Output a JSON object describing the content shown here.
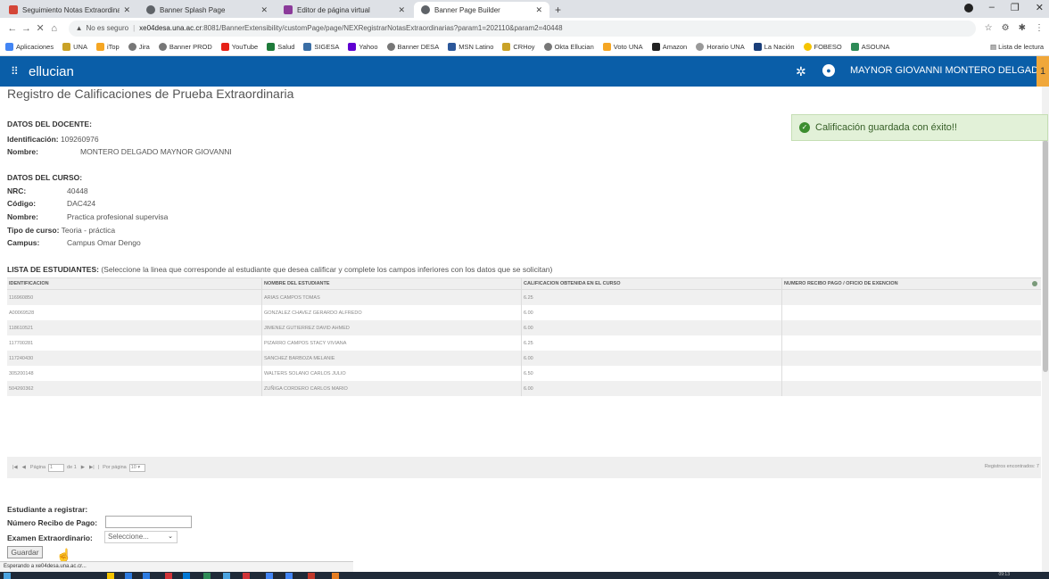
{
  "browser": {
    "tabs": [
      {
        "title": "Seguimiento Notas Extraordinar",
        "color": "#d44638"
      },
      {
        "title": "Banner Splash Page",
        "color": "#5f6368"
      },
      {
        "title": "Editor de página virtual",
        "color": "#8b3a9a"
      },
      {
        "title": "Banner Page Builder",
        "color": "#5f6368"
      }
    ],
    "address": {
      "security": "No es seguro",
      "host": "xe04desa.una.ac.cr",
      "path": ":8081/BannerExtensibility/customPage/page/NEXRegistrarNotasExtraordinarias?param1=202110&param2=40448"
    },
    "bookmarks": [
      "Aplicaciones",
      "UNA",
      "iTop",
      "Jira",
      "Banner PROD",
      "YouTube",
      "Salud",
      "SIGESA",
      "Yahoo",
      "Banner DESA",
      "MSN Latino",
      "CRHoy",
      "Okta Ellucian",
      "Voto UNA",
      "Amazon",
      "Horario UNA",
      "La Nación",
      "FOBESO",
      "ASOUNA"
    ],
    "reading_list": "Lista de lectura"
  },
  "app": {
    "brand": "ellucian",
    "user": "MAYNOR GIOVANNI MONTERO DELGADO",
    "notif_count": "1",
    "toast": "Calificación guardada con éxito!!"
  },
  "page": {
    "title": "Registro de Calificaciones de Prueba Extraordinaria",
    "docente": {
      "heading": "DATOS DEL DOCENTE:",
      "id_label": "Identificación:",
      "id_value": "109260976",
      "name_label": "Nombre:",
      "name_value": "MONTERO DELGADO MAYNOR GIOVANNI"
    },
    "curso": {
      "heading": "DATOS DEL CURSO:",
      "nrc_label": "NRC:",
      "nrc_value": "40448",
      "codigo_label": "Código:",
      "codigo_value": "DAC424",
      "nombre_label": "Nombre:",
      "nombre_value": "Practica profesional supervisa",
      "tipo_label": "Tipo de curso:",
      "tipo_value": "Teoria - práctica",
      "campus_label": "Campus:",
      "campus_value": "Campus Omar Dengo"
    },
    "list": {
      "heading": "LISTA DE ESTUDIANTES:",
      "instructions": "(Seleccione la linea que corresponde al estudiante que desea calificar y complete los campos inferiores con los datos que se solicitan)",
      "columns": [
        "IDENTIFICACION",
        "NOMBRE DEL ESTUDIANTE",
        "CALIFICACION OBTENIDA EN EL CURSO",
        "NUMERO RECIBO PAGO / OFICIO DE EXENCION"
      ],
      "rows": [
        [
          "116960850",
          "ARIAS CAMPOS TOMAS",
          "6.25",
          ""
        ],
        [
          "A00069528",
          "GONZALEZ CHAVEZ GERARDO ALFREDO",
          "6.00",
          ""
        ],
        [
          "118610521",
          "JIMENEZ GUTIERREZ DAVID AHMED",
          "6.00",
          ""
        ],
        [
          "117700281",
          "PIZARRO CAMPOS STACY VIVIANA",
          "6.25",
          ""
        ],
        [
          "117240430",
          "SANCHEZ BARBOZA MELANIE",
          "6.00",
          ""
        ],
        [
          "305200148",
          "WALTERS SOLANO CARLOS JULIO",
          "6.50",
          ""
        ],
        [
          "504260362",
          "ZUÑIGA CORDERO CARLOS MARIO",
          "6.00",
          ""
        ]
      ]
    },
    "pager": {
      "page_label": "Página",
      "page_value": "1",
      "of_label": "de 1",
      "per_page_label": "Por página",
      "per_page_value": "10",
      "records": "Registros encontrados: 7"
    },
    "form": {
      "heading": "Estudiante a registrar:",
      "receipt_label": "Número Recibo de Pago:",
      "receipt_value": "",
      "exam_label": "Examen Extraordinario:",
      "exam_value": "Seleccione...",
      "save_label": "Guardar"
    },
    "status": "Esperando a xe04desa.una.ac.cr..."
  },
  "taskbar": {
    "clock": "09:13"
  }
}
